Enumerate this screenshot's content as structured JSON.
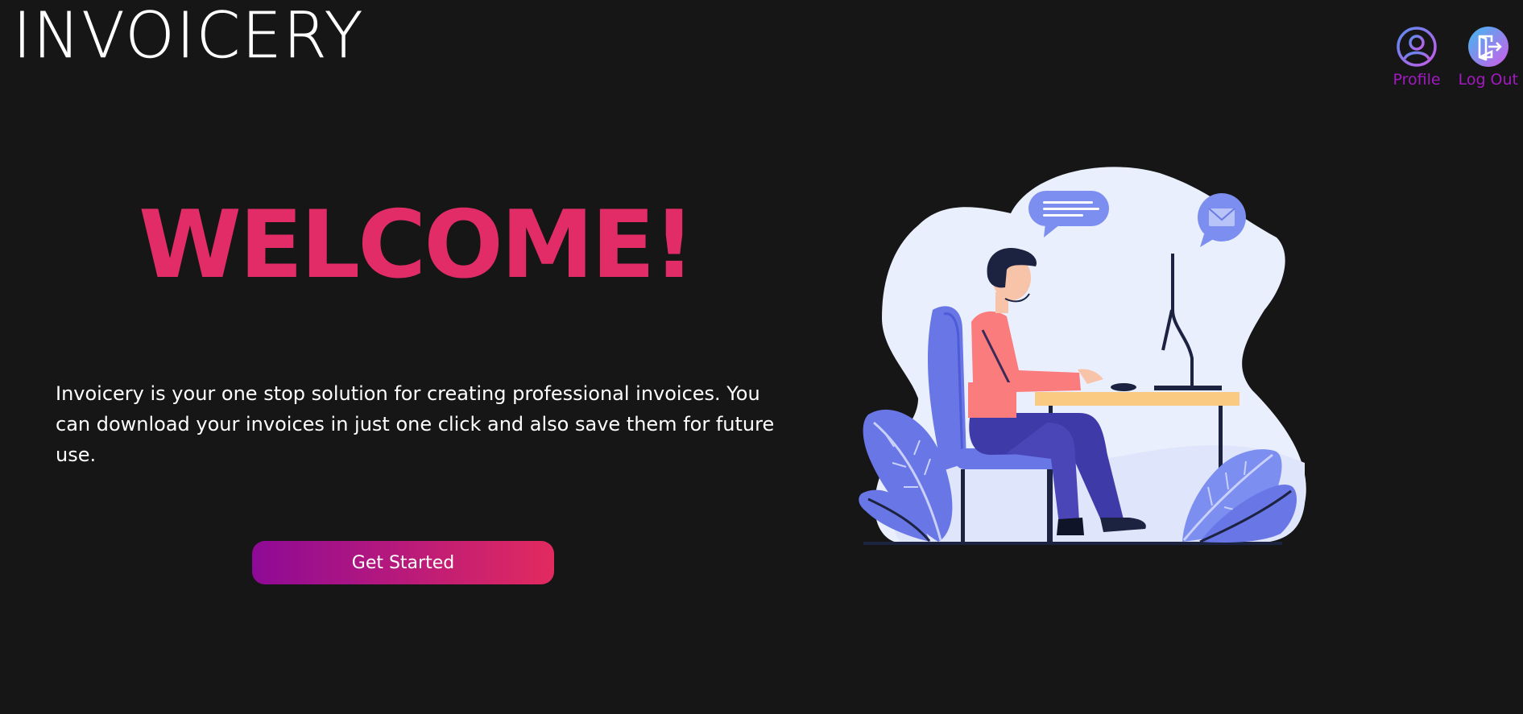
{
  "header": {
    "logo_text": "INVOICERY",
    "nav": [
      {
        "label": "Profile",
        "icon": "profile-icon"
      },
      {
        "label": "Log Out",
        "icon": "logout-icon"
      }
    ]
  },
  "hero": {
    "title": "WELCOME!",
    "description": "Invoicery is your one stop solution for creating professional invoices. You can download your invoices in just one click and also save them for future use.",
    "cta_label": "Get Started"
  },
  "colors": {
    "background": "#161616",
    "accent": "#e22c68",
    "nav_label": "#a31ac2",
    "gradient_start": "#8e0a96",
    "gradient_end": "#e22a5f"
  }
}
